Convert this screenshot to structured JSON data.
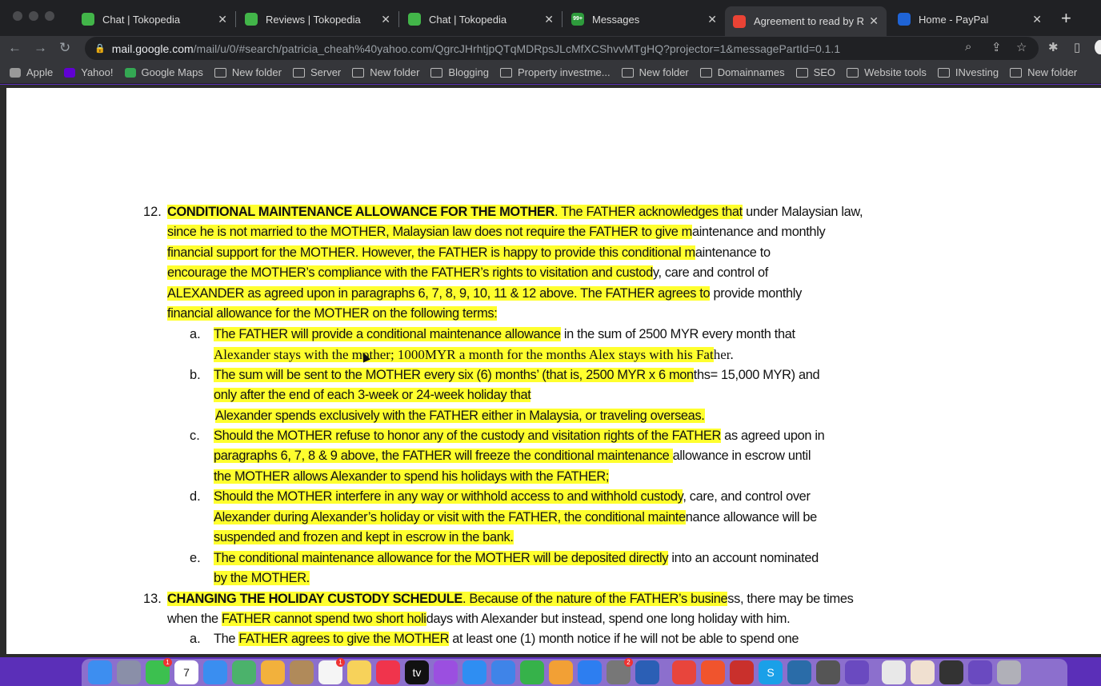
{
  "browser": {
    "tabs": [
      {
        "title": "Chat | Tokopedia",
        "icon": "tokopedia-icon",
        "color": "#42b549"
      },
      {
        "title": "Reviews | Tokopedia",
        "icon": "tokopedia-icon",
        "color": "#42b549"
      },
      {
        "title": "Chat | Tokopedia",
        "icon": "tokopedia-icon",
        "color": "#42b549"
      },
      {
        "title": "Messages",
        "icon": "messages-icon",
        "color": "#2e9b3c",
        "badge": "99+"
      },
      {
        "title": "Agreement to read by Ra",
        "icon": "gmail-icon",
        "color": "#ea4335",
        "active": true
      },
      {
        "title": "Home - PayPal",
        "icon": "paypal-icon",
        "color": "#1f64d6"
      }
    ],
    "url_host": "mail.google.com",
    "url_path": "/mail/u/0/#search/patricia_cheah%40yahoo.com/QgrcJHrhtjpQTqMDRpsJLcMfXCShvvMTgHQ?projector=1&messagePartId=0.1.1",
    "bookmarks": [
      {
        "label": "Apple",
        "icon": "apple-icon"
      },
      {
        "label": "Yahoo!",
        "icon": "yahoo-icon"
      },
      {
        "label": "Google Maps",
        "icon": "maps-icon"
      },
      {
        "label": "New folder",
        "icon": "folder-icon"
      },
      {
        "label": "Server",
        "icon": "folder-icon"
      },
      {
        "label": "New folder",
        "icon": "folder-icon"
      },
      {
        "label": "Blogging",
        "icon": "folder-icon"
      },
      {
        "label": "Property investme...",
        "icon": "folder-icon"
      },
      {
        "label": "New folder",
        "icon": "folder-icon"
      },
      {
        "label": "Domainnames",
        "icon": "folder-icon"
      },
      {
        "label": "SEO",
        "icon": "folder-icon"
      },
      {
        "label": "Website tools",
        "icon": "folder-icon"
      },
      {
        "label": "INvesting",
        "icon": "folder-icon"
      },
      {
        "label": "New folder",
        "icon": "folder-icon"
      }
    ]
  },
  "document": {
    "lines": [
      {
        "m": "12.",
        "lv": 0,
        "bold": "CONDITIONAL MAINTENANCE ALLOWANCE FOR THE MOTHER",
        "t": [
          "",
          ". The FATHER acknowledges that",
          " under Malaysian law,"
        ]
      },
      {
        "lv": 0,
        "t": [
          "",
          "since he is not married to the MOTHER, Malaysian law does not require the FATHER to give m",
          "aintenance and monthly"
        ]
      },
      {
        "lv": 0,
        "t": [
          "",
          "financial support for the MOTHER. However, the FATHER is happy to provide this conditional m",
          "aintenance to"
        ]
      },
      {
        "lv": 0,
        "t": [
          "",
          "encourage the MOTHER’s compliance with the FATHER’s rights to visitation and custod",
          "y, care and control of"
        ]
      },
      {
        "lv": 0,
        "t": [
          "",
          "ALEXANDER as agreed upon in paragraphs 6, 7, 8, 9, 10, 11 & 12 above. The FATHER agrees to",
          " provide monthly"
        ]
      },
      {
        "lv": 0,
        "t": [
          "",
          "financial allowance for the MOTHER on the following terms:",
          ""
        ]
      },
      {
        "m": "a.",
        "lv": 1,
        "t": [
          "",
          "The FATHER will provide a conditional maintenance allowance",
          " in the sum of 2500 MYR every month that"
        ]
      },
      {
        "lv": 1,
        "serif": true,
        "t": [
          "",
          "Alexander stays with the mother; 1000MYR a month for the months Alex stays with his Fat",
          "her."
        ]
      },
      {
        "m": "b.",
        "lv": 1,
        "t": [
          "",
          "The sum will be sent to the MOTHER every six (6) months’ (that is, 2500 MYR x 6 mon",
          "ths= 15,000 MYR) and"
        ]
      },
      {
        "lv": 1,
        "t": [
          "",
          "only after the end of each 3-week or 24-week holiday that",
          ""
        ]
      },
      {
        "lv": 1,
        "t": [
          "",
          "Alexander spends exclusively with the FATHER either in Malaysia, or traveling overseas.",
          ""
        ]
      },
      {
        "m": "c.",
        "lv": 1,
        "t": [
          "",
          "Should the MOTHER refuse to honor any of the custody and visitation rights of the FATHER",
          " as agreed upon in"
        ]
      },
      {
        "lv": 1,
        "t": [
          "",
          "paragraphs 6, 7, 8 & 9 above, the FATHER will freeze the conditional maintenance ",
          "allowance in escrow until"
        ]
      },
      {
        "lv": 1,
        "t": [
          "",
          "the MOTHER allows Alexander to spend his holidays with the FATHER;",
          ""
        ]
      },
      {
        "m": "d.",
        "lv": 1,
        "t": [
          "",
          "Should the MOTHER interfere in any way or withhold access to and withhold custody",
          ", care, and control over"
        ]
      },
      {
        "lv": 1,
        "t": [
          "",
          "Alexander during Alexander’s holiday or visit with the FATHER, the conditional mainte",
          "nance allowance will be"
        ]
      },
      {
        "lv": 1,
        "t": [
          "",
          "suspended and frozen and kept in escrow in the bank.",
          ""
        ]
      },
      {
        "m": "e.",
        "lv": 1,
        "t": [
          "",
          "The conditional maintenance allowance for the MOTHER will be deposited directly",
          " into an account nominated"
        ]
      },
      {
        "lv": 1,
        "t": [
          "",
          "by the MOTHER.",
          ""
        ]
      },
      {
        "m": "13.",
        "lv": 0,
        "bold": "CHANGING THE HOLIDAY CUSTODY SCHEDULE",
        "t": [
          "",
          ". Because of the nature of the FATHER’s busine",
          "ss, there may be times"
        ]
      },
      {
        "lv": 0,
        "t": [
          "when the ",
          "FATHER cannot spend two short holi",
          "days with Alexander but instead, spend one long holiday with him."
        ]
      },
      {
        "m": "a.",
        "lv": 1,
        "t": [
          "The ",
          "FATHER agrees to give the MOTHER",
          " at least one (1) month notice if he will not be able to spend one"
        ]
      }
    ]
  },
  "dock": {
    "apps": [
      {
        "name": "finder",
        "color": "#3d8ef0"
      },
      {
        "name": "launchpad",
        "color": "#8a8fa8"
      },
      {
        "name": "facetime",
        "color": "#3cc04f",
        "badge": "1"
      },
      {
        "name": "calendar",
        "color": "#ffffff",
        "label": "7"
      },
      {
        "name": "mail",
        "color": "#3a8ef0"
      },
      {
        "name": "maps",
        "color": "#4bb26b"
      },
      {
        "name": "photos",
        "color": "#f2b13c"
      },
      {
        "name": "contacts",
        "color": "#b08a5a"
      },
      {
        "name": "reminders",
        "color": "#f5f5f5",
        "badge": "1"
      },
      {
        "name": "notes",
        "color": "#f7d25a"
      },
      {
        "name": "music",
        "color": "#f0344c"
      },
      {
        "name": "apple-tv",
        "color": "#111111",
        "label": "tv"
      },
      {
        "name": "podcasts",
        "color": "#9b4fe0"
      },
      {
        "name": "safari",
        "color": "#2f8ef2"
      },
      {
        "name": "keynote",
        "color": "#3f84e8"
      },
      {
        "name": "numbers",
        "color": "#36b24a"
      },
      {
        "name": "pages",
        "color": "#f2a035"
      },
      {
        "name": "app-store",
        "color": "#2d7ef0"
      },
      {
        "name": "system-preferences",
        "color": "#777777",
        "badge": "2"
      },
      {
        "name": "word",
        "color": "#2b5fb5"
      },
      {
        "name": "chrome",
        "color": "#e8453c"
      },
      {
        "name": "brave",
        "color": "#f0542d"
      },
      {
        "name": "lastpass",
        "color": "#c9302c"
      },
      {
        "name": "skype",
        "color": "#1aa0e8",
        "label": "S"
      },
      {
        "name": "quicktime",
        "color": "#2a6ca8"
      },
      {
        "name": "calculator",
        "color": "#555555"
      },
      {
        "name": "screen-recorder",
        "color": "#6a4ac0"
      },
      {
        "name": "document",
        "color": "#e8e8e8"
      },
      {
        "name": "document-2",
        "color": "#f0e0d0"
      },
      {
        "name": "document-3",
        "color": "#333333"
      },
      {
        "name": "screen-recorder-2",
        "color": "#6a4ac0"
      },
      {
        "name": "trash",
        "color": "#b0b0b8"
      }
    ]
  }
}
